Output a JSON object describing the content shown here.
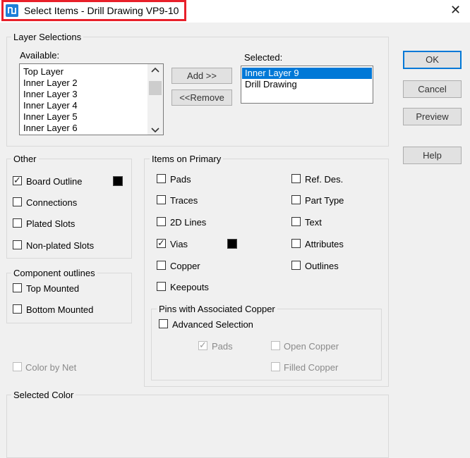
{
  "window": {
    "title": "Select Items - Drill Drawing VP9-10",
    "close_glyph": "✕"
  },
  "layer_selections": {
    "legend": "Layer Selections",
    "available_label": "Available:",
    "available": [
      "Top Layer",
      "Inner Layer 2",
      "Inner Layer 3",
      "Inner Layer 4",
      "Inner Layer 5",
      "Inner Layer 6"
    ],
    "selected_label": "Selected:",
    "selected": [
      "Inner Layer 9",
      "Drill Drawing"
    ],
    "add_label": "Add >>",
    "remove_label": "<<Remove"
  },
  "buttons": {
    "ok": "OK",
    "cancel": "Cancel",
    "preview": "Preview",
    "help": "Help"
  },
  "other": {
    "legend": "Other",
    "items": [
      {
        "label": "Board Outline",
        "checked": true
      },
      {
        "label": "Connections",
        "checked": false
      },
      {
        "label": "Plated Slots",
        "checked": false
      },
      {
        "label": "Non-plated Slots",
        "checked": false
      }
    ]
  },
  "component_outlines": {
    "legend": "Component outlines",
    "items": [
      {
        "label": "Top Mounted",
        "checked": false
      },
      {
        "label": "Bottom Mounted",
        "checked": false
      }
    ]
  },
  "color_by_net": {
    "label": "Color by Net",
    "checked": false,
    "disabled": true
  },
  "items_on_primary": {
    "legend": "Items on Primary",
    "left": [
      {
        "label": "Pads",
        "checked": false
      },
      {
        "label": "Traces",
        "checked": false
      },
      {
        "label": "2D Lines",
        "checked": false
      },
      {
        "label": "Vias",
        "checked": true
      },
      {
        "label": "Copper",
        "checked": false
      },
      {
        "label": "Keepouts",
        "checked": false
      }
    ],
    "right": [
      {
        "label": "Ref. Des.",
        "checked": false
      },
      {
        "label": "Part Type",
        "checked": false
      },
      {
        "label": "Text",
        "checked": false
      },
      {
        "label": "Attributes",
        "checked": false
      },
      {
        "label": "Outlines",
        "checked": false
      }
    ]
  },
  "pins_copper": {
    "legend": "Pins with Associated Copper",
    "advanced": "Advanced Selection",
    "pads": "Pads",
    "open_copper": "Open Copper",
    "filled_copper": "Filled Copper"
  },
  "selected_color": {
    "legend": "Selected Color"
  },
  "colors": {
    "accent": "#0078d7",
    "highlight": "#e8202a",
    "swatch": "#000000"
  }
}
